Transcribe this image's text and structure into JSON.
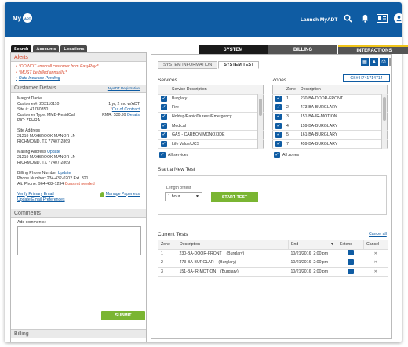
{
  "header": {
    "logo_prefix": "My",
    "logo_mark": "ADT",
    "launch": "Launch MyADT",
    "icons": [
      "search-icon",
      "bell-icon",
      "id-card-icon",
      "user-icon"
    ]
  },
  "left_tabs": [
    "Search",
    "Accounts",
    "Locations"
  ],
  "alerts": {
    "title": "Alerts",
    "items": [
      "*DO NOT unenroll customer from EasyPay.*",
      "*MUST be billed annually.*",
      "Rate Increase Pending"
    ]
  },
  "customer": {
    "title": "Customer Details",
    "registration": "MyADT Registration",
    "name": "Margot Daniel",
    "customer_no": "Customer#: 203110110",
    "site_no": "Site #: 41780350",
    "tenure": "1 yr, 2 mo w/ADT",
    "contract": "Out of Contract",
    "contract_prefix": "*",
    "type": "Customer Type: MMB-ResidCal",
    "rmr": "RMR: $30.99",
    "rmr_details": "Details",
    "pic": "PIC: ZEHRA",
    "site_addr_label": "Site Address",
    "site_addr_1": "21219 MAYBROOK MANOR LN",
    "site_addr_2": "RICHMOND, TX 77407-2869",
    "mail_label": "Mailing Address",
    "mail_update": "Update",
    "mail_addr_1": "21219 MAYBROOK MANOR LN",
    "mail_addr_2": "RICHMOND, TX 77407-2869",
    "phone_label": "Billing Phone Number",
    "phone_update": "Update",
    "phone_no": "Phone Number:   234-432-0202  Ext. 321",
    "alt_phone": "Alt. Phone:         964-432-1234",
    "consent": "Consent needed",
    "verify_email": "Verify Primary Email",
    "update_email": "Update Email Preferences",
    "paperless": "Manage Paperless"
  },
  "comments": {
    "title": "Comments",
    "label": "Add comments:",
    "submit": "SUBMIT"
  },
  "billing_title": "Billing",
  "right_tabs": [
    "SYSTEM",
    "BILLING",
    "INTERACTIONS"
  ],
  "sub_tabs": [
    "SYSTEM INFORMATION",
    "SYSTEM TEST"
  ],
  "cs_number": "CS# H741714714",
  "services": {
    "label": "Services",
    "header": "Service Description",
    "items": [
      "Burglary",
      "Fire",
      "Holdup/Panic/Duress/Emergency",
      "Medical",
      "GAS - CARBON MONOXIDE",
      "Life Value/UCS"
    ],
    "all": "All services"
  },
  "zones": {
    "label": "Zones",
    "header_zone": "Zone",
    "header_desc": "Description",
    "items": [
      {
        "zone": "1",
        "desc": "230-BA-DOOR-FRONT"
      },
      {
        "zone": "2",
        "desc": "473-BA-BURGLARY"
      },
      {
        "zone": "3",
        "desc": "151-BA-IR-MOTION"
      },
      {
        "zone": "4",
        "desc": "159-BA-BURGLARY"
      },
      {
        "zone": "5",
        "desc": "161-BA-BURGLARY"
      },
      {
        "zone": "7",
        "desc": "459-BA-BURGLARY"
      }
    ],
    "all": "All zones"
  },
  "new_test": {
    "label": "Start a New Test",
    "length_label": "Length of test",
    "length_value": "1 hour",
    "start": "START TEST"
  },
  "current_tests": {
    "label": "Current Tests",
    "cancel_all": "Cancel all",
    "headers": [
      "Zone",
      "Description",
      "End",
      "Extend",
      "Cancel"
    ],
    "rows": [
      {
        "zone": "1",
        "desc": "230-BA-DOOR-FRONT",
        "type": "(Burglary)",
        "date": "10/21/2016",
        "time": "2:00 pm"
      },
      {
        "zone": "2",
        "desc": "473-BA-BURGLAR",
        "type": "(Burglary)",
        "date": "10/21/2016",
        "time": "2:00 pm"
      },
      {
        "zone": "3",
        "desc": "151-BA-IR-MOTION",
        "type": "(Burglary)",
        "date": "10/21/2016",
        "time": "2:00 pm"
      }
    ]
  }
}
